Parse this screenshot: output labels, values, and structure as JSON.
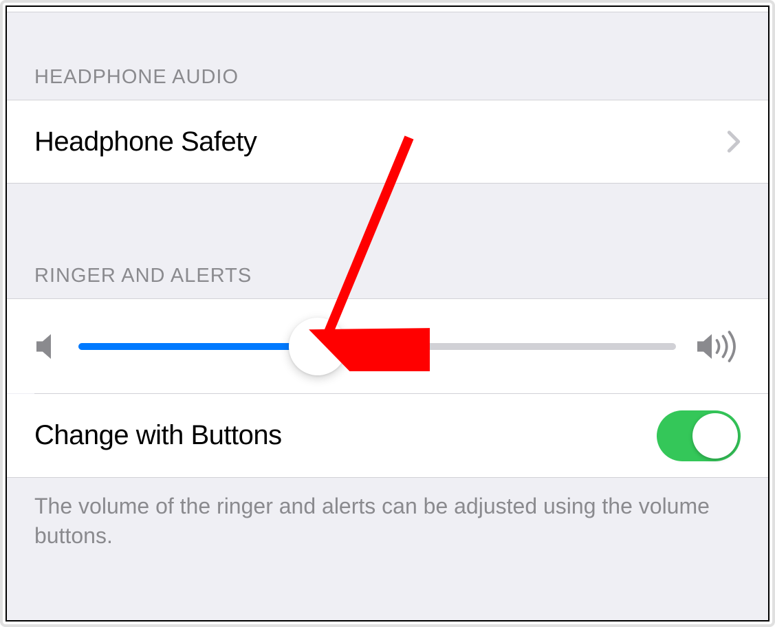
{
  "sections": {
    "headphone_audio": {
      "header": "HEADPHONE AUDIO",
      "items": {
        "headphone_safety": {
          "label": "Headphone Safety"
        }
      }
    },
    "ringer_and_alerts": {
      "header": "RINGER AND ALERTS",
      "slider": {
        "value_percent": 40
      },
      "change_with_buttons": {
        "label": "Change with Buttons",
        "enabled": true
      },
      "footer": "The volume of the ringer and alerts can be adjusted using the volume buttons."
    }
  },
  "colors": {
    "accent": "#007aff",
    "toggle_on": "#34c759",
    "section_bg": "#efeff4",
    "secondary_text": "#8a8a8e"
  }
}
